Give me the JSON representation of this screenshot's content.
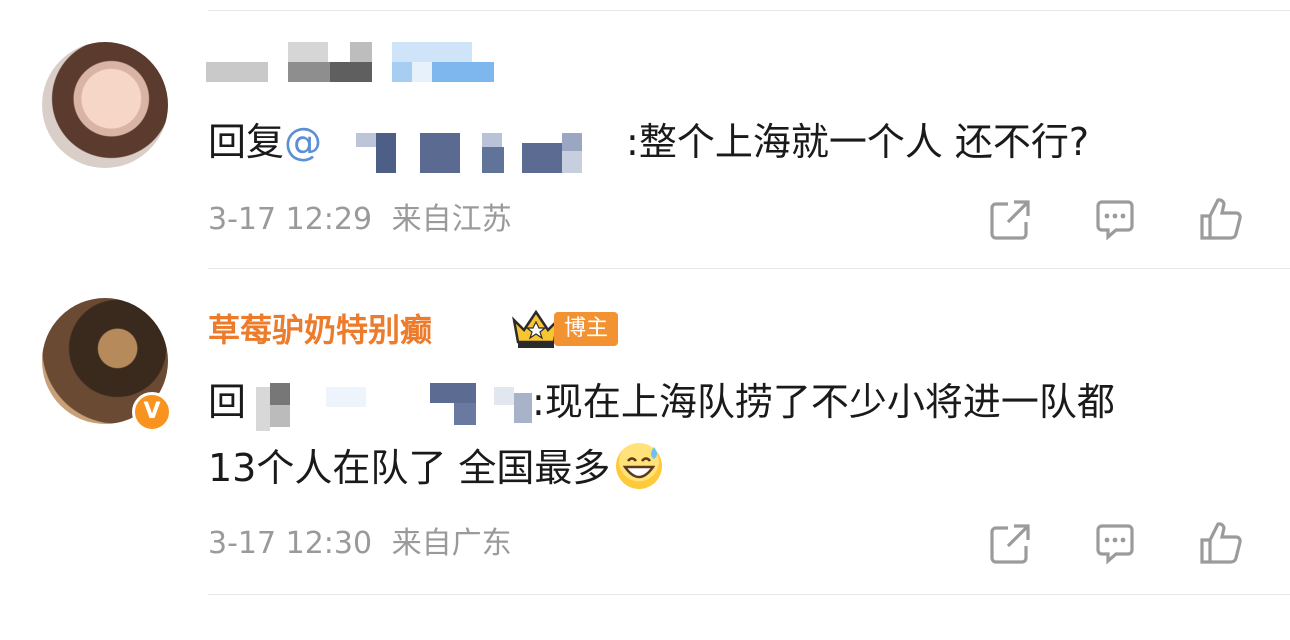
{
  "comments": [
    {
      "username": "",
      "text_prefix": "回复",
      "mention_symbol": "@",
      "text_body": ":整个上海就一个人 还不行?",
      "timestamp": "3-17 12:29",
      "location": "来自江苏"
    },
    {
      "username": "草莓驴奶特别癫",
      "badge": "博主",
      "verified_label": "V",
      "text_prefix": "回",
      "text_body": ":现在上海队捞了不少小将进一队都",
      "text_line2": "13个人在队了 全国最多",
      "timestamp": "3-17 12:30",
      "location": "来自广东"
    }
  ],
  "colors": {
    "username_orange": "#ed7b2c",
    "badge_orange": "#f29230",
    "meta_gray": "#9a9a9a",
    "icon_gray": "#9b9b9b"
  },
  "icons": [
    "share-icon",
    "comment-icon",
    "like-icon",
    "crown-icon",
    "grin-sweat-emoji-icon"
  ]
}
